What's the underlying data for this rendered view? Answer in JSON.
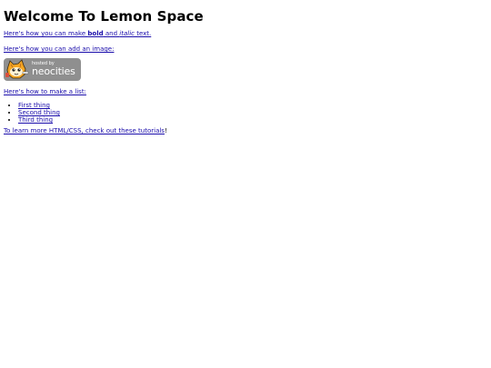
{
  "page": {
    "heading": "Welcome To Lemon Space",
    "bold_paragraph": {
      "prefix": "Here's how you can make ",
      "bold": "bold",
      "middle": " and ",
      "italic": "italic",
      "suffix": " text."
    },
    "image_paragraph": "Here's how you can add an image:",
    "badge": {
      "hosted_text": "hosted by",
      "name_text": "neocities",
      "icon": "neocities-cat-icon"
    },
    "list_paragraph": "Here's how to make a list:",
    "list_items": [
      "First thing",
      "Second thing",
      "Third thing"
    ],
    "learn_paragraph": {
      "link_text": "To learn more HTML/CSS, check out these tutorials",
      "suffix": "!"
    }
  },
  "colors": {
    "link": "#1a0dab",
    "badge_bg": "#8f8f8f",
    "text": "#000000"
  }
}
